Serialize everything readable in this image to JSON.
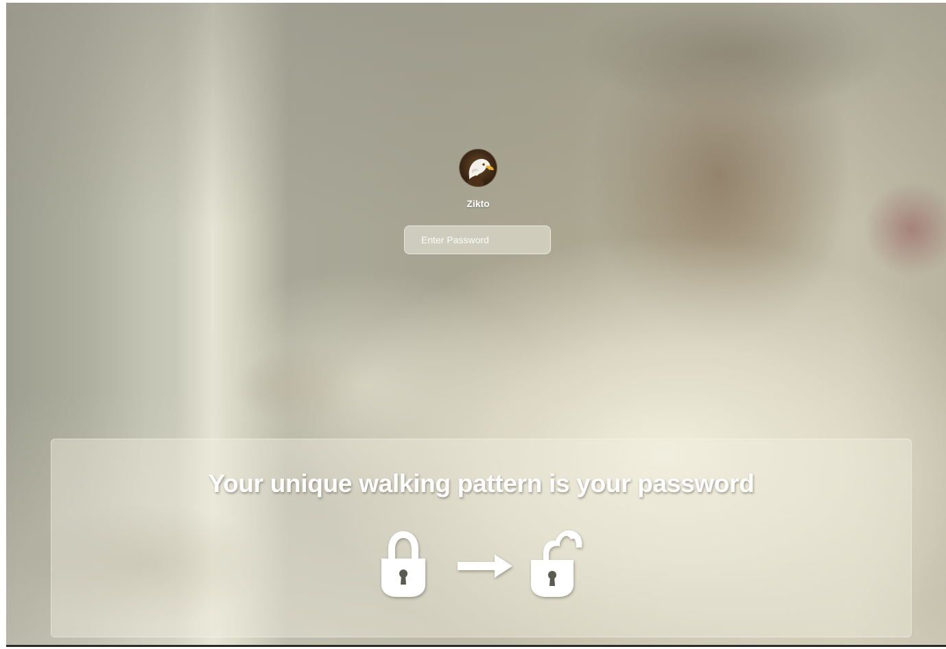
{
  "login": {
    "username": "Zikto",
    "avatar_icon": "eagle-avatar-icon",
    "password_placeholder": "Enter Password"
  },
  "info_panel": {
    "tagline": "Your unique walking pattern is your password",
    "icons": [
      "lock-closed-icon",
      "arrow-right-icon",
      "lock-open-icon"
    ]
  },
  "colors": {
    "text": "#ffffff",
    "panel_tint": "#f0eee1",
    "avatar_bg": "#3a2614"
  }
}
